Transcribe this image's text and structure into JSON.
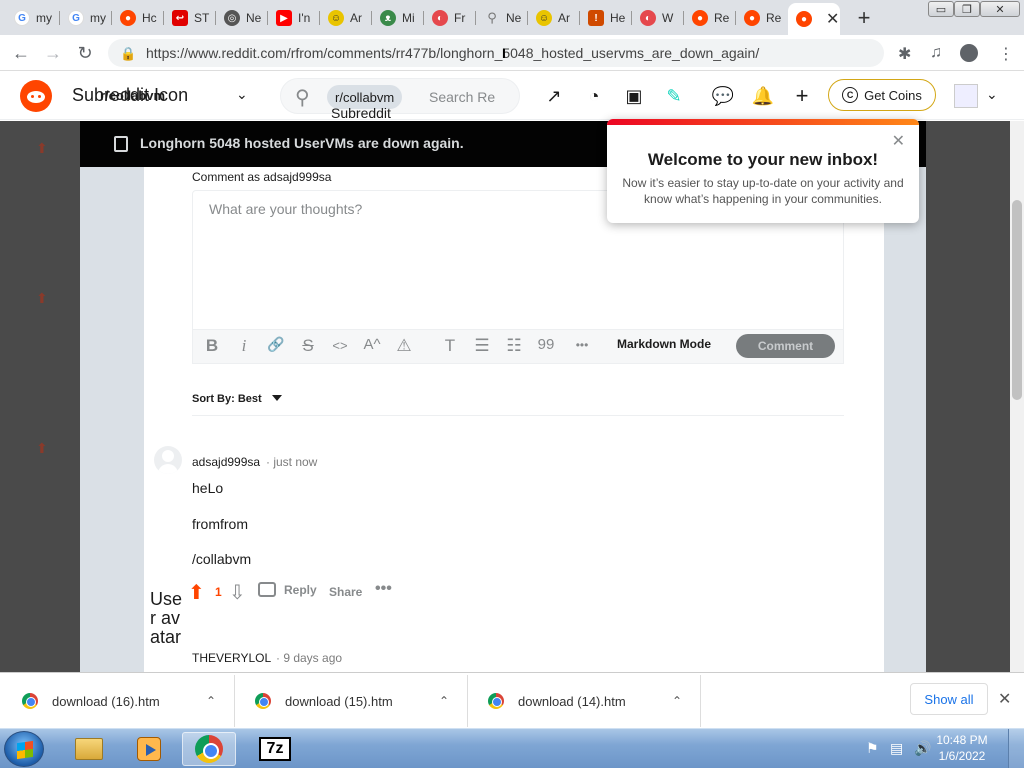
{
  "browser": {
    "tabs": [
      {
        "label": "my",
        "icon": "google-icon",
        "color": "#4285f4"
      },
      {
        "label": "my",
        "icon": "google-icon",
        "color": "#4285f4"
      },
      {
        "label": "Hc",
        "icon": "reddit-icon",
        "color": "#ff4500"
      },
      {
        "label": "ST",
        "icon": "red-icon",
        "color": "#e00000"
      },
      {
        "label": "Ne",
        "icon": "globe-icon",
        "color": "#555555"
      },
      {
        "label": "I'n",
        "icon": "youtube-icon",
        "color": "#ff0000"
      },
      {
        "label": "Ar",
        "icon": "emoji-icon",
        "color": "#e9c400"
      },
      {
        "label": "Mi",
        "icon": "cat-icon",
        "color": "#3a8a4a"
      },
      {
        "label": "Fr",
        "icon": "red-circle-icon",
        "color": "#e5484d"
      },
      {
        "label": "Ne",
        "icon": "search-icon",
        "color": "#777777"
      },
      {
        "label": "Ar",
        "icon": "emoji-icon",
        "color": "#e9c400"
      },
      {
        "label": "He",
        "icon": "badge-icon",
        "color": "#d04a00"
      },
      {
        "label": "W",
        "icon": "red-circle-icon",
        "color": "#e5484d"
      },
      {
        "label": "Re",
        "icon": "reddit-icon",
        "color": "#ff4500"
      },
      {
        "label": "Re",
        "icon": "reddit-icon",
        "color": "#ff4500"
      },
      {
        "label": "",
        "icon": "reddit-icon",
        "color": "#ff4500",
        "active": true
      }
    ],
    "new_tab": "+",
    "window_controls": {
      "minimize": "▭",
      "restore": "❐",
      "close": "✕"
    },
    "url": "https://www.reddit.com/rfrom/comments/rr477b/longhorn_5048_hosted_uservms_are_down_again/",
    "nav": {
      "back": "←",
      "forward": "→",
      "reload": "↻"
    }
  },
  "reddit_header": {
    "subreddit_icon_alt": "Subreddit Icon",
    "subreddit": "r/collabvm",
    "search_pill": "r/collabvm",
    "search_pill_alt": "Subreddit",
    "search_placeholder": "Search Re",
    "get_coins": "Get Coins",
    "coin_symbol": "C"
  },
  "post": {
    "title": "Longhorn 5048 hosted UserVMs are down again."
  },
  "comment_box": {
    "comment_as": "Comment as adsajd999sa",
    "placeholder": "What are your thoughts?",
    "tools": [
      "B",
      "i",
      "🔗",
      "S",
      "<>",
      "A^",
      "⚠",
      "T",
      "☰",
      "☷",
      "99",
      "•••"
    ],
    "markdown_mode": "Markdown Mode",
    "submit": "Comment"
  },
  "sort": {
    "label": "Sort By: Best"
  },
  "comments": [
    {
      "author": "adsajd999sa",
      "time": "· just now",
      "lines": [
        "heLo",
        "fromfrom",
        "/collabvm"
      ],
      "score": "1",
      "reply": "Reply",
      "share": "Share",
      "more": "•••"
    },
    {
      "author_avatar_alt": "User avatar",
      "author": "THEVERYLOL",
      "time": "· 9 days ago"
    }
  ],
  "popup": {
    "title": "Welcome to your new inbox!",
    "body": "Now it’s easier to stay up-to-date on your activity and know what’s happening in your communities.",
    "close": "✕"
  },
  "downloads": [
    {
      "name": "download (16).htm"
    },
    {
      "name": "download (15).htm"
    },
    {
      "name": "download (14).htm"
    }
  ],
  "downloads_show_all": "Show all",
  "downloads_close": "✕",
  "taskbar": {
    "seven_zip": "7z",
    "time": "10:48 PM",
    "date": "1/6/2022"
  }
}
